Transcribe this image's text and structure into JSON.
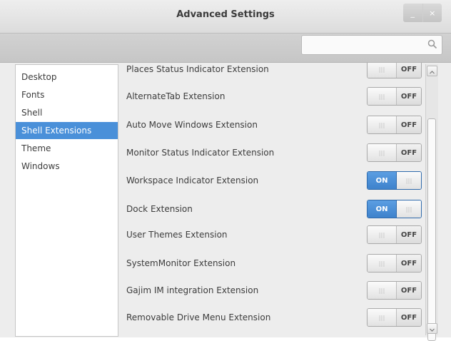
{
  "window": {
    "title": "Advanced Settings",
    "minimize_glyph": "_",
    "close_glyph": "×"
  },
  "search": {
    "placeholder": "",
    "value": "",
    "icon": "search-icon"
  },
  "sidebar": {
    "items": [
      {
        "label": "Desktop",
        "selected": false
      },
      {
        "label": "Fonts",
        "selected": false
      },
      {
        "label": "Shell",
        "selected": false
      },
      {
        "label": "Shell Extensions",
        "selected": true
      },
      {
        "label": "Theme",
        "selected": false
      },
      {
        "label": "Windows",
        "selected": false
      }
    ]
  },
  "extensions": [
    {
      "label": "Places Status Indicator Extension",
      "state": "OFF"
    },
    {
      "label": "AlternateTab Extension",
      "state": "OFF"
    },
    {
      "label": "Auto Move Windows Extension",
      "state": "OFF"
    },
    {
      "label": "Monitor Status Indicator Extension",
      "state": "OFF"
    },
    {
      "label": "Workspace Indicator Extension",
      "state": "ON"
    },
    {
      "label": "Dock Extension",
      "state": "ON"
    },
    {
      "label": "User Themes Extension",
      "state": "OFF"
    },
    {
      "label": "SystemMonitor Extension",
      "state": "OFF"
    },
    {
      "label": "Gajim IM integration Extension",
      "state": "OFF"
    },
    {
      "label": "Removable Drive Menu Extension",
      "state": "OFF"
    }
  ],
  "switch_grip": "|||",
  "colors": {
    "selection": "#4a90d9",
    "switch_on": "#4a90d9"
  }
}
